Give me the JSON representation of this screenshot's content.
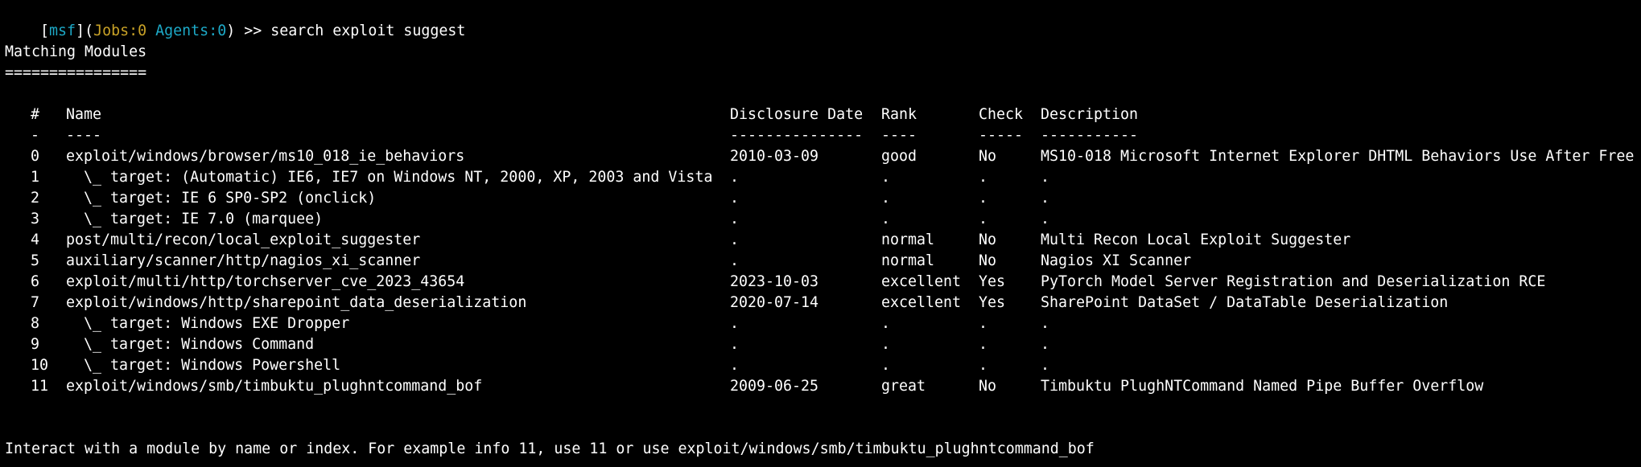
{
  "colors": {
    "background": "#000000",
    "text": "#ffffff",
    "prompt_msf": "#1da9c7",
    "prompt_jobs": "#c9a227",
    "prompt_agents": "#1da9c7"
  },
  "prompt": {
    "open_bracket": "[",
    "msf": "msf",
    "close_bracket_paren": "](",
    "jobs": "Jobs",
    "jobs_value": ":0 ",
    "agents": "Agents",
    "agents_value": ":0",
    "suffix": ") >> ",
    "command": "search exploit suggest"
  },
  "section_title": "Matching Modules",
  "section_underline": "================",
  "table": {
    "headers": {
      "num": "#",
      "name": "Name",
      "date": "Disclosure Date",
      "rank": "Rank",
      "check": "Check",
      "desc": "Description"
    },
    "separators": {
      "num": "-",
      "name": "----",
      "date": "---------------",
      "rank": "----",
      "check": "-----",
      "desc": "-----------"
    },
    "rows": [
      {
        "num": "0",
        "name": "exploit/windows/browser/ms10_018_ie_behaviors",
        "date": "2010-03-09",
        "rank": "good",
        "check": "No",
        "desc": "MS10-018 Microsoft Internet Explorer DHTML Behaviors Use After Free"
      },
      {
        "num": "1",
        "name": "  \\_ target: (Automatic) IE6, IE7 on Windows NT, 2000, XP, 2003 and Vista",
        "date": ".",
        "rank": ".",
        "check": ".",
        "desc": "."
      },
      {
        "num": "2",
        "name": "  \\_ target: IE 6 SP0-SP2 (onclick)",
        "date": ".",
        "rank": ".",
        "check": ".",
        "desc": "."
      },
      {
        "num": "3",
        "name": "  \\_ target: IE 7.0 (marquee)",
        "date": ".",
        "rank": ".",
        "check": ".",
        "desc": "."
      },
      {
        "num": "4",
        "name": "post/multi/recon/local_exploit_suggester",
        "date": ".",
        "rank": "normal",
        "check": "No",
        "desc": "Multi Recon Local Exploit Suggester"
      },
      {
        "num": "5",
        "name": "auxiliary/scanner/http/nagios_xi_scanner",
        "date": ".",
        "rank": "normal",
        "check": "No",
        "desc": "Nagios XI Scanner"
      },
      {
        "num": "6",
        "name": "exploit/multi/http/torchserver_cve_2023_43654",
        "date": "2023-10-03",
        "rank": "excellent",
        "check": "Yes",
        "desc": "PyTorch Model Server Registration and Deserialization RCE"
      },
      {
        "num": "7",
        "name": "exploit/windows/http/sharepoint_data_deserialization",
        "date": "2020-07-14",
        "rank": "excellent",
        "check": "Yes",
        "desc": "SharePoint DataSet / DataTable Deserialization"
      },
      {
        "num": "8",
        "name": "  \\_ target: Windows EXE Dropper",
        "date": ".",
        "rank": ".",
        "check": ".",
        "desc": "."
      },
      {
        "num": "9",
        "name": "  \\_ target: Windows Command",
        "date": ".",
        "rank": ".",
        "check": ".",
        "desc": "."
      },
      {
        "num": "10",
        "name": "  \\_ target: Windows Powershell",
        "date": ".",
        "rank": ".",
        "check": ".",
        "desc": "."
      },
      {
        "num": "11",
        "name": "exploit/windows/smb/timbuktu_plughntcommand_bof",
        "date": "2009-06-25",
        "rank": "great",
        "check": "No",
        "desc": "Timbuktu PlughNTCommand Named Pipe Buffer Overflow"
      }
    ]
  },
  "footer": "Interact with a module by name or index. For example info 11, use 11 or use exploit/windows/smb/timbuktu_plughntcommand_bof"
}
